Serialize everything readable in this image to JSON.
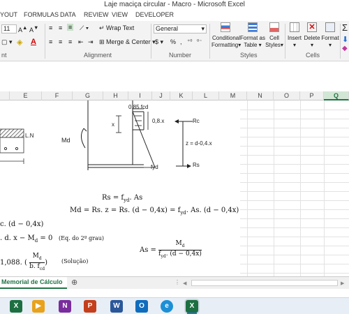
{
  "window": {
    "title": "Laje maciça circular - Macro - Microsoft Excel"
  },
  "ribbon_tabs": [
    "YOUT",
    "FORMULAS",
    "DATA",
    "REVIEW",
    "VIEW",
    "DEVELOPER"
  ],
  "ribbon": {
    "font_size": "11",
    "wrap_text": "Wrap Text",
    "merge_center": "Merge & Center",
    "number_format": "General",
    "percent": "%",
    "comma": ",",
    "conditional": "Conditional",
    "formatting": "Formatting",
    "format_as": "Format as",
    "table": "Table",
    "cell": "Cell",
    "styles_btn": "Styles",
    "insert": "Insert",
    "delete": "Delete",
    "format": "Format",
    "groups": {
      "font_partial": "nt",
      "alignment": "Alignment",
      "number": "Number",
      "styles": "Styles",
      "cells": "Cells"
    }
  },
  "columns": [
    "E",
    "F",
    "G",
    "H",
    "I",
    "J",
    "K",
    "L",
    "M",
    "N",
    "O",
    "P",
    "Q"
  ],
  "selected_column": "Q",
  "diagram": {
    "stress_label": "0.85.fcd",
    "x_label": "x",
    "block_label": "0,8.x",
    "rc_label": "Rc",
    "z_label": "z = d-0,4.x",
    "rs_label": "Rs",
    "fyd_label": "fyd",
    "md_label": "Md",
    "ln_label": "L.N"
  },
  "equations": {
    "rs": "Rs = f",
    "rs_sub": "yd",
    "rs_tail": ". As",
    "md_line": "Md = Rs. z = Rs. (d − 0,4x) = f",
    "md_sub": "yd",
    "md_tail": ". As. (d − 0,4x)",
    "left1": "c. (d − 0,4x)",
    "left2": ". d. x − M",
    "left2_sub": "d",
    "left2_tail": " = 0",
    "eq2grau": "(Eq. do 2º grau)",
    "left3_head": "1,088. (",
    "left3_num": "M",
    "left3_num_sub": "d",
    "left3_den": "b. f",
    "left3_den_sub": "cd",
    "left3_tail": ")",
    "solucao": "(Solução)",
    "as_lhs": "As =",
    "as_num": "M",
    "as_num_sub": "d",
    "as_den": "f",
    "as_den_sub": "yd",
    "as_den_tail": ". (d − 0,4x)"
  },
  "sheet_tab": "Memorial de Cálculo",
  "add_sheet": "⊕",
  "taskbar": [
    "X",
    "▶",
    "N",
    "P",
    "W",
    "O",
    "e",
    "X"
  ]
}
